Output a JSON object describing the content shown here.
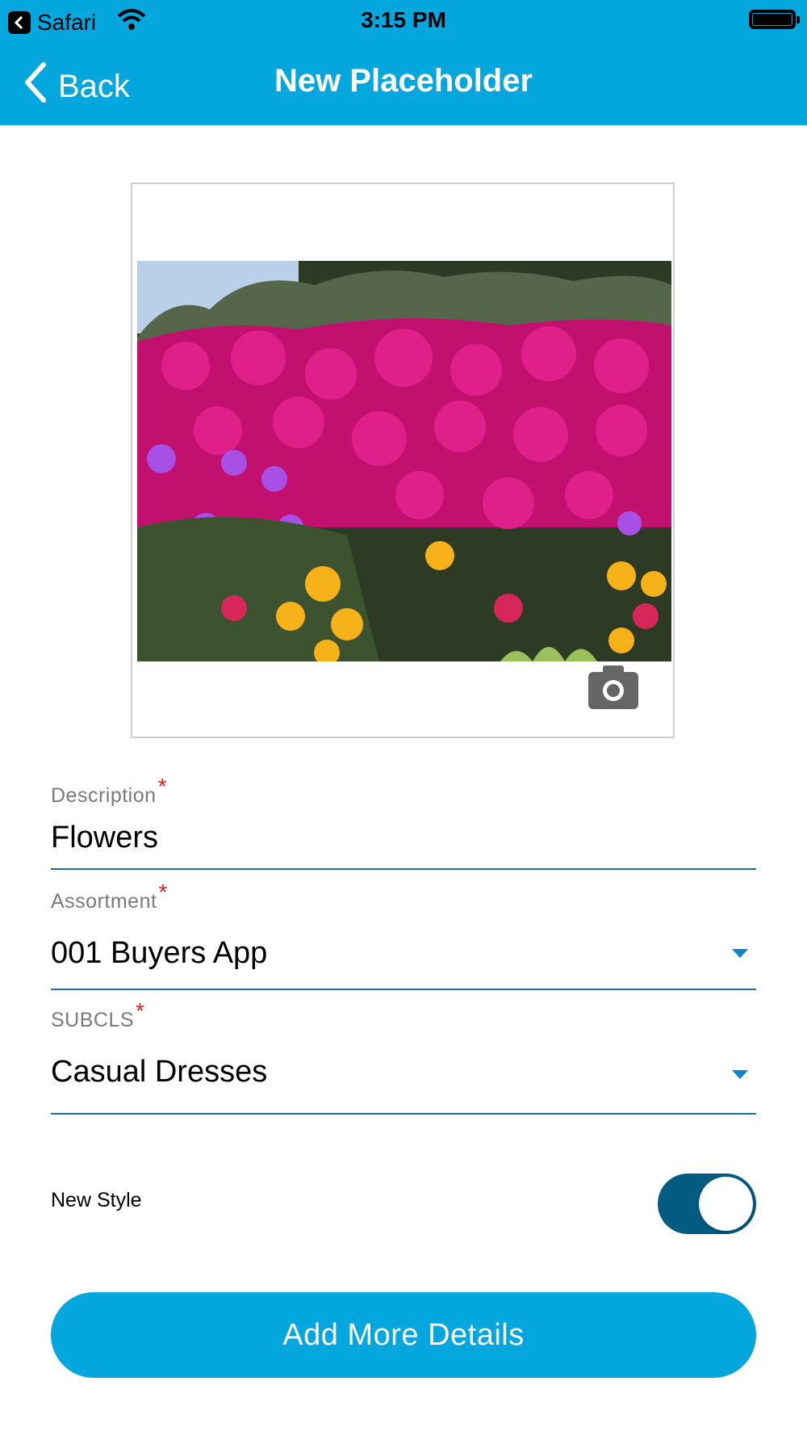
{
  "status_bar": {
    "app_back_label": "Safari",
    "time": "3:15 PM"
  },
  "nav": {
    "back_label": "Back",
    "title": "New Placeholder"
  },
  "photo": {
    "description": "photo of pink, purple and yellow flowers"
  },
  "form": {
    "description": {
      "label": "Description",
      "required_mark": "*",
      "value": "Flowers"
    },
    "assortment": {
      "label": "Assortment",
      "required_mark": "*",
      "value": "001 Buyers App"
    },
    "subcls": {
      "label": "SUBCLS",
      "required_mark": "*",
      "value": "Casual Dresses"
    }
  },
  "new_style": {
    "label": "New Style",
    "on": true
  },
  "cta": {
    "label": "Add More Details"
  },
  "colors": {
    "header": "#03a6dd",
    "toggle_on": "#025c82",
    "required": "#e02020",
    "underline": "#1f6f8b"
  }
}
